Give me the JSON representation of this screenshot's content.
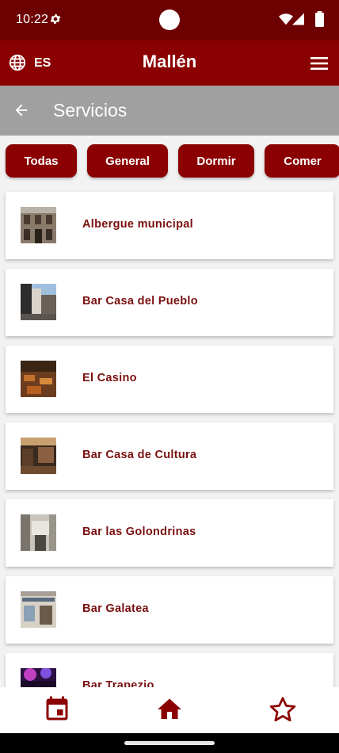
{
  "status": {
    "time": "10:22"
  },
  "header": {
    "language": "ES",
    "title": "Mallén"
  },
  "subheader": {
    "title": "Servicios"
  },
  "filters": [
    {
      "label": "Todas"
    },
    {
      "label": "General"
    },
    {
      "label": "Dormir"
    },
    {
      "label": "Comer"
    }
  ],
  "items": [
    {
      "name": "Albergue municipal"
    },
    {
      "name": "Bar Casa del Pueblo"
    },
    {
      "name": "El Casino"
    },
    {
      "name": "Bar Casa de Cultura"
    },
    {
      "name": "Bar las Golondrinas"
    },
    {
      "name": "Bar Galatea"
    },
    {
      "name": "Bar Trapezio"
    }
  ],
  "colors": {
    "primary": "#8b0000",
    "status_bar": "#6d0000",
    "subheader": "#a0a0a0",
    "item_text": "#7a1010"
  },
  "icons": [
    "settings-icon",
    "wifi-icon",
    "signal-icon",
    "battery-icon",
    "globe-icon",
    "menu-icon",
    "back-arrow-icon",
    "calendar-icon",
    "home-icon",
    "star-icon"
  ]
}
